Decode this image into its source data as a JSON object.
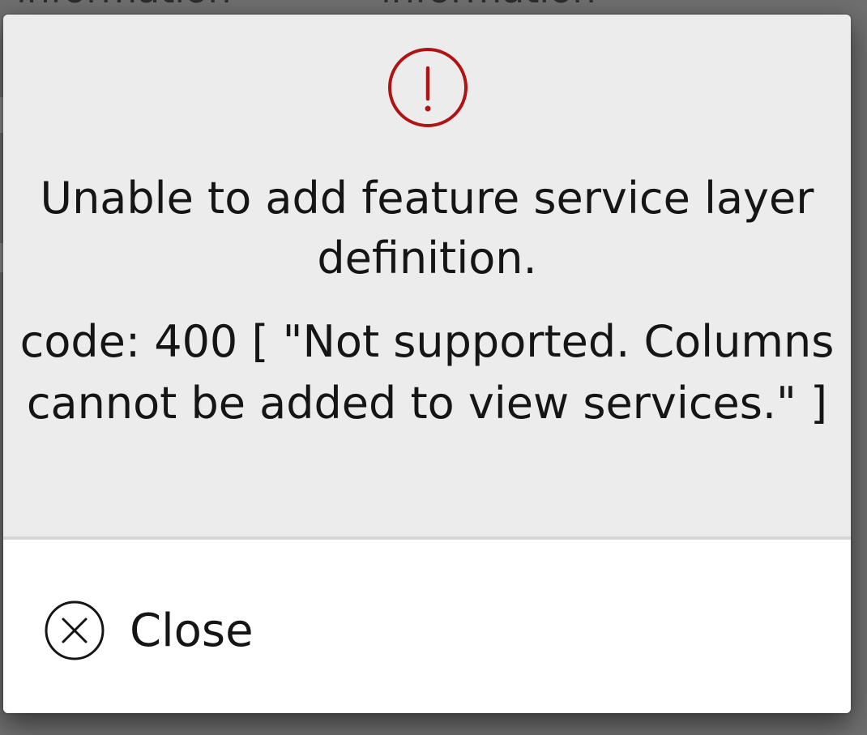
{
  "background": {
    "fragments": [
      "information",
      "information"
    ]
  },
  "dialog": {
    "title": "Unable to add feature service layer definition.",
    "detail": "code: 400 [ \"Not supported. Columns cannot be added to view services.\" ]",
    "close_label": "Close"
  },
  "icons": {
    "alert": "exclamation-circle-icon",
    "close": "x-circle-icon"
  },
  "colors": {
    "alert": "#b01313",
    "text": "#151515",
    "panel": "#ececec",
    "footer": "#ffffff",
    "backdrop": "#6f6f6f"
  }
}
